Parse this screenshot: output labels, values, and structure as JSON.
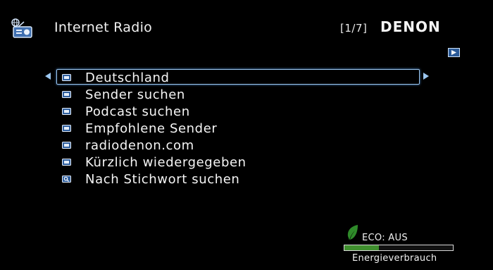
{
  "header": {
    "title": "Internet Radio",
    "page_indicator": "[1/7]",
    "brand": "DENON",
    "app_icon": "internet-radio-icon",
    "next_page_icon": "play-right-icon"
  },
  "menu": {
    "items": [
      {
        "label": "Deutschland",
        "icon": "folder-icon",
        "selected": true
      },
      {
        "label": "Sender suchen",
        "icon": "folder-icon",
        "selected": false
      },
      {
        "label": "Podcast suchen",
        "icon": "folder-icon",
        "selected": false
      },
      {
        "label": "Empfohlene Sender",
        "icon": "folder-icon",
        "selected": false
      },
      {
        "label": "radiodenon.com",
        "icon": "folder-icon",
        "selected": false
      },
      {
        "label": "Kürzlich wiedergegeben",
        "icon": "folder-icon",
        "selected": false
      },
      {
        "label": "Nach Stichwort suchen",
        "icon": "search-icon",
        "selected": false
      }
    ]
  },
  "eco": {
    "status": "ECO: AUS",
    "caption": "Energieverbrauch",
    "level": 0.32,
    "leaf_icon": "leaf-icon",
    "accent": "#3f8f2e",
    "selection_color": "#9cc7f0"
  }
}
